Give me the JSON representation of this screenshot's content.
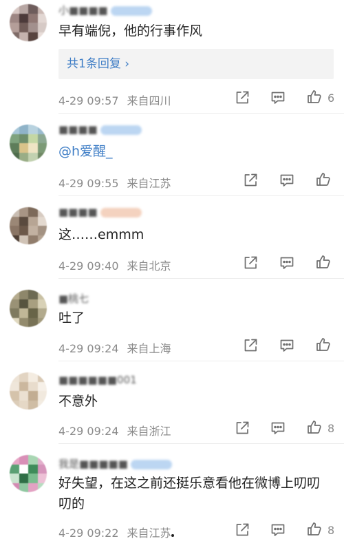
{
  "comments": [
    {
      "username": "小■■■■",
      "text": "早有端倪，他的行事作风",
      "reply_label": "共1条回复 ›",
      "time": "4-29 09:57",
      "source": "来自四川",
      "likes": "6",
      "avatar_colors": [
        "#d8c8c4",
        "#b7a6a3",
        "#6e5d5c",
        "#cbb9b4",
        "#9d8683",
        "#4c3a3a",
        "#8f7773",
        "#e2d7d3",
        "#b49e99",
        "#715c58",
        "#a2908d",
        "#d6cac6",
        "#7e6b67",
        "#c5b3ae",
        "#58443f",
        "#e8ddd9"
      ]
    },
    {
      "username": "■■■■",
      "text_prefix": "",
      "mention": "@h爱醒_",
      "time": "4-29 09:55",
      "source": "来自江苏",
      "likes": "",
      "avatar_colors": [
        "#a8c7d8",
        "#8fb3c8",
        "#b8d2df",
        "#9bbcd0",
        "#7fa37e",
        "#6e8e6b",
        "#c4d7a4",
        "#8ca892",
        "#5e7d5a",
        "#d9c38a",
        "#efe4c4",
        "#7c9a76",
        "#4f6c4c",
        "#99ad86",
        "#c2d1b0",
        "#6f8864"
      ]
    },
    {
      "username": "■■■■",
      "text": "这……emmm",
      "time": "4-29 09:40",
      "source": "来自北京",
      "likes": "",
      "avatar_colors": [
        "#c9bdb2",
        "#a89585",
        "#7d6a5a",
        "#d7cbc1",
        "#9b8776",
        "#5a4a3e",
        "#b7a594",
        "#e3d9cf",
        "#8a7565",
        "#6c5849",
        "#c2b1a1",
        "#a39282",
        "#4e3f35",
        "#d0c3b6",
        "#917d6c",
        "#b3a291"
      ]
    },
    {
      "username": "■桃七",
      "text": "吐了",
      "time": "4-29 09:24",
      "source": "来自上海",
      "likes": "",
      "avatar_colors": [
        "#b5ab8e",
        "#8e876b",
        "#6d6a52",
        "#c9c1a4",
        "#9a9276",
        "#57543f",
        "#a89f80",
        "#d8d1b6",
        "#7f7a5f",
        "#c0b797",
        "#686448",
        "#b2aa8d",
        "#e0d9c0",
        "#938b6d",
        "#787256",
        "#a29a7c"
      ]
    },
    {
      "username": "■■■■■■001",
      "text": "不意外",
      "time": "4-29 09:24",
      "source": "来自浙江",
      "likes": "8",
      "avatar_colors": [
        "#ede3d6",
        "#e2d4c2",
        "#f4ece1",
        "#d9c9b4",
        "#efe6da",
        "#cbb79e",
        "#e8dccc",
        "#f6f0e8",
        "#d5c3ab",
        "#ebe0d1",
        "#c2ad92",
        "#f1e9de",
        "#dccdb9",
        "#e5d8c6",
        "#cfbda4",
        "#f3ece2"
      ]
    },
    {
      "username": "我是■■■■■",
      "text": "好失望，在这之前还挺乐意看他在微博上叨叨叨的",
      "time": "4-29 09:22",
      "source": "来自江苏",
      "likes": "8",
      "avatar_colors": [
        "#e7a7c6",
        "#d98fb7",
        "#a9d6b3",
        "#e3b0cc",
        "#5aa073",
        "#ffffff",
        "#3f8c5a",
        "#d695bb",
        "#c9e5cf",
        "#2f6e46",
        "#7bbd8f",
        "#edc1d6",
        "#d48ab3",
        "#8fc7a0",
        "#e3a2c3",
        "#b6ddc0"
      ]
    }
  ]
}
